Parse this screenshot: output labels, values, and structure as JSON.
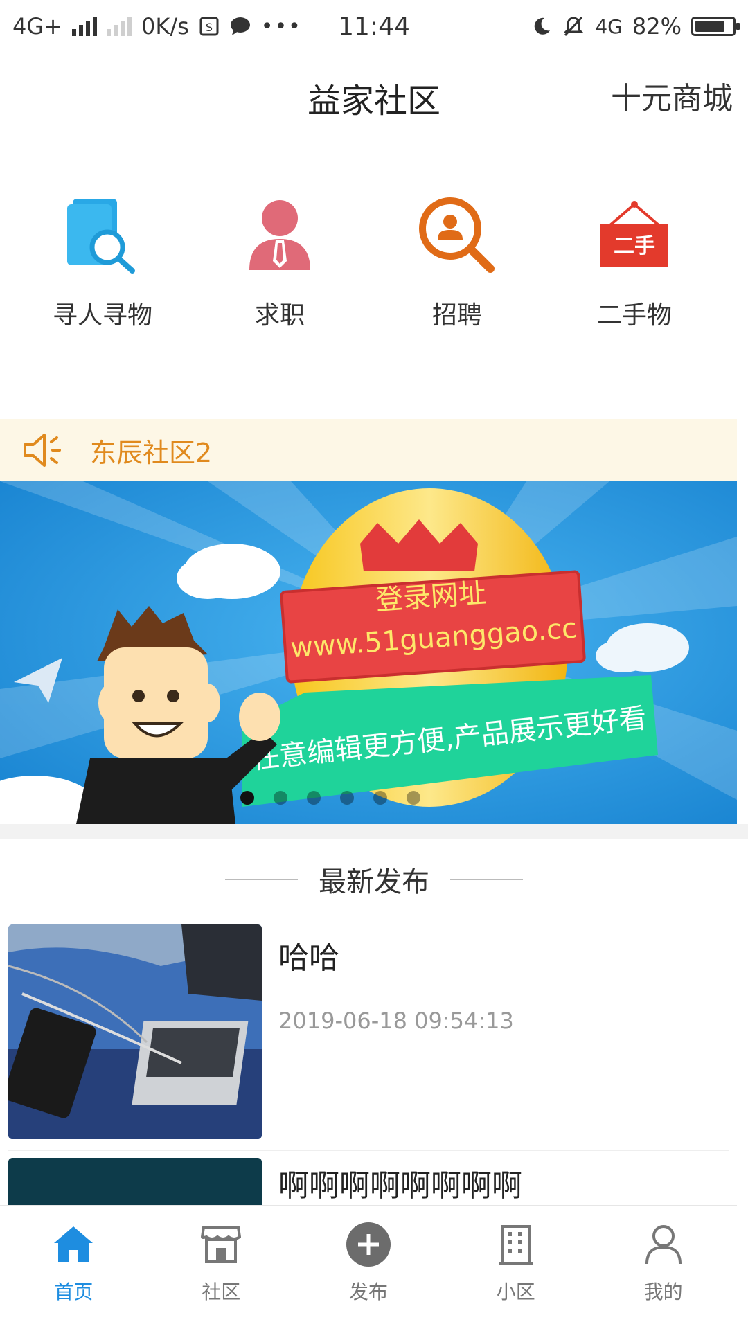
{
  "status_bar": {
    "network": "4G+",
    "speed": "0K/s",
    "time": "11:44",
    "network2": "4G",
    "battery": "82%",
    "battery_level": 0.82,
    "icons": [
      "signal-icon",
      "sim-icon",
      "chat-icon",
      "more-icon",
      "moon-icon",
      "mute-icon",
      "battery-icon"
    ]
  },
  "header": {
    "title": "益家社区",
    "right_link": "十元商城"
  },
  "quick_actions": [
    {
      "label": "寻人寻物",
      "icon": "search-document-icon",
      "color": "#29a8e6"
    },
    {
      "label": "求职",
      "icon": "person-tie-icon",
      "color": "#e06a78"
    },
    {
      "label": "招聘",
      "icon": "search-person-icon",
      "color": "#e06b17"
    },
    {
      "label": "二手物",
      "icon": "secondhand-sign-icon",
      "color": "#e33a2c",
      "badge": "二手"
    }
  ],
  "notice": {
    "text": "东辰社区2",
    "icon": "speaker-icon",
    "color": "#e08a1e"
  },
  "banner": {
    "heading": "登录网址",
    "url": "www.51guanggao.cc",
    "slogan": "任意编辑更方便,产品展示更好看",
    "dots_count": 6,
    "active_dot": 0
  },
  "latest": {
    "section_title": "最新发布",
    "posts": [
      {
        "title": "哈哈",
        "time": "2019-06-18 09:54:13"
      },
      {
        "title": "啊啊啊啊啊啊啊啊",
        "time": ""
      }
    ]
  },
  "tab_bar": {
    "active_color": "#1e8de0",
    "items": [
      {
        "label": "首页",
        "icon": "home-icon",
        "active": true
      },
      {
        "label": "社区",
        "icon": "store-icon",
        "active": false
      },
      {
        "label": "发布",
        "icon": "plus-circle-icon",
        "active": false
      },
      {
        "label": "小区",
        "icon": "building-icon",
        "active": false
      },
      {
        "label": "我的",
        "icon": "user-icon",
        "active": false
      }
    ]
  }
}
